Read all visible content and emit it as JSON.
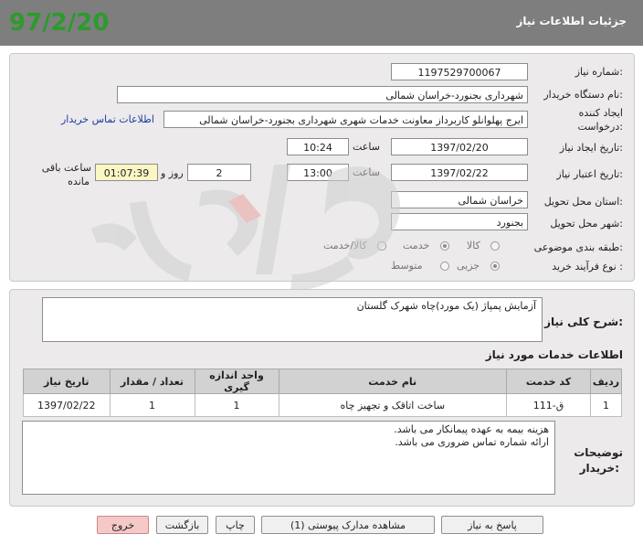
{
  "header": {
    "title": "جزئیات اطلاعات نیاز",
    "date": "97/2/20"
  },
  "form": {
    "need_number": {
      "label": "شماره نیاز:",
      "value": "1197529700067"
    },
    "buyer_org": {
      "label": "نام دستگاه خریدار:",
      "value": "شهرداری بجنورد-خراسان شمالی"
    },
    "requester": {
      "label_line1": "ایجاد کننده",
      "label_line2": "درخواست:",
      "value": "ایرج پهلوانلو کاربرداز معاونت خدمات شهری شهرداری بجنورد-خراسان شمالی",
      "contact_link": "اطلاعات تماس خریدار"
    },
    "created": {
      "label": "تاریخ ایجاد نیاز:",
      "date": "1397/02/20",
      "time_label": "ساعت",
      "time": "10:24"
    },
    "validity": {
      "label": "تاریخ اعتبار نیاز:",
      "date": "1397/02/22",
      "time_label": "ساعت",
      "time": "13:00",
      "days": "2",
      "days_label": "روز و",
      "remaining": "01:07:39",
      "remaining_label_line1": "ساعت باقی",
      "remaining_label_line2": "مانده"
    },
    "province": {
      "label": "استان محل تحویل:",
      "value": "خراسان شمالی"
    },
    "city": {
      "label": "شهر محل تحویل:",
      "value": "بجنورد"
    },
    "category": {
      "label": "طبقه بندی موضوعی:",
      "options": [
        "کالا",
        "خدمت",
        "کالا/خدمت"
      ],
      "selected": "خدمت"
    },
    "process": {
      "label": "نوع فرآیند خرید :",
      "options": [
        "جزیی",
        "متوسط"
      ],
      "selected": "جزیی"
    }
  },
  "summary": {
    "label": "شرح کلی نیاز:",
    "value": "آزمایش پمپاژ (یک مورد)چاه شهرک گلستان"
  },
  "services": {
    "title": "اطلاعات خدمات مورد نیاز",
    "columns": [
      "ردیف",
      "کد خدمت",
      "نام خدمت",
      "واحد اندازه گیری",
      "تعداد / مقدار",
      "تاریخ نیاز"
    ],
    "rows": [
      {
        "row": "1",
        "code": "ق-111",
        "name": "ساخت اتاقک و تجهیز چاه",
        "unit": "1",
        "qty": "1",
        "date": "1397/02/22"
      }
    ]
  },
  "buyer_notes": {
    "label_line1": "توضیحات",
    "label_line2": "خریدار:",
    "line1": "هزینه بیمه به عهده پیمانکار می باشد.",
    "line2": "ارائه شماره تماس ضروری می باشد."
  },
  "buttons": {
    "reply": "پاسخ به نیاز",
    "attachments": "مشاهده مدارک پیوستی (1)",
    "print": "چاپ",
    "back": "بازگشت",
    "exit": "خروج"
  },
  "colors": {
    "header_bg": "#7e7e7e",
    "date_green": "#2c9b2c",
    "panel_bg": "#eceaea",
    "link": "#1a3ea8",
    "timer_bg": "#fbf7c4"
  }
}
